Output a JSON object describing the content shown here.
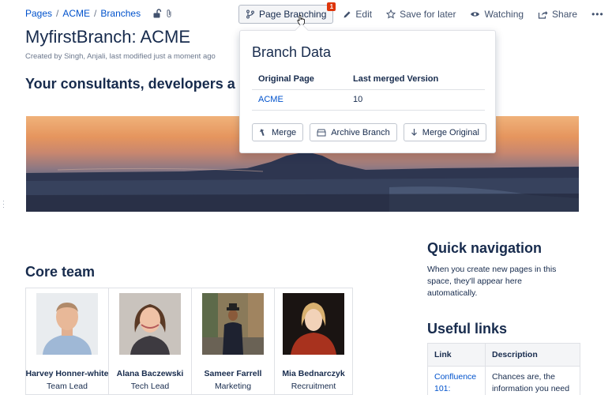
{
  "breadcrumb": {
    "items": [
      "Pages",
      "ACME",
      "Branches"
    ],
    "separator": "/"
  },
  "toolbar": {
    "page_branching": "Page Branching",
    "badge": "1",
    "edit": "Edit",
    "save_for_later": "Save for later",
    "watching": "Watching",
    "share": "Share",
    "more": "•••"
  },
  "page": {
    "title": "MyfirstBranch: ACME",
    "byline": "Created by Singh, Anjali, last modified just a moment ago",
    "heading_consultants": "Your consultants, developers a"
  },
  "popup": {
    "title": "Branch Data",
    "col_original": "Original Page",
    "col_merged": "Last merged Version",
    "row_original": "ACME",
    "row_version": "10",
    "btn_merge": "Merge",
    "btn_archive": "Archive Branch",
    "btn_merge_original": "Merge Original"
  },
  "core_team": {
    "heading": "Core team",
    "members": [
      {
        "name": "Harvey Honner-white",
        "role": "Team Lead"
      },
      {
        "name": "Alana Baczewski",
        "role": "Tech Lead"
      },
      {
        "name": "Sameer Farrell",
        "role": "Marketing"
      },
      {
        "name": "Mia Bednarczyk",
        "role": "Recruitment"
      }
    ]
  },
  "quick_nav": {
    "heading": "Quick navigation",
    "text": "When you create new pages in this space, they'll appear here automatically."
  },
  "useful_links": {
    "heading": "Useful links",
    "col_link": "Link",
    "col_description": "Description",
    "row_link": "Confluence 101:",
    "row_description": "Chances are, the information you need"
  },
  "colors": {
    "link": "#0052cc",
    "text": "#172b4d",
    "badge": "#de350b"
  }
}
